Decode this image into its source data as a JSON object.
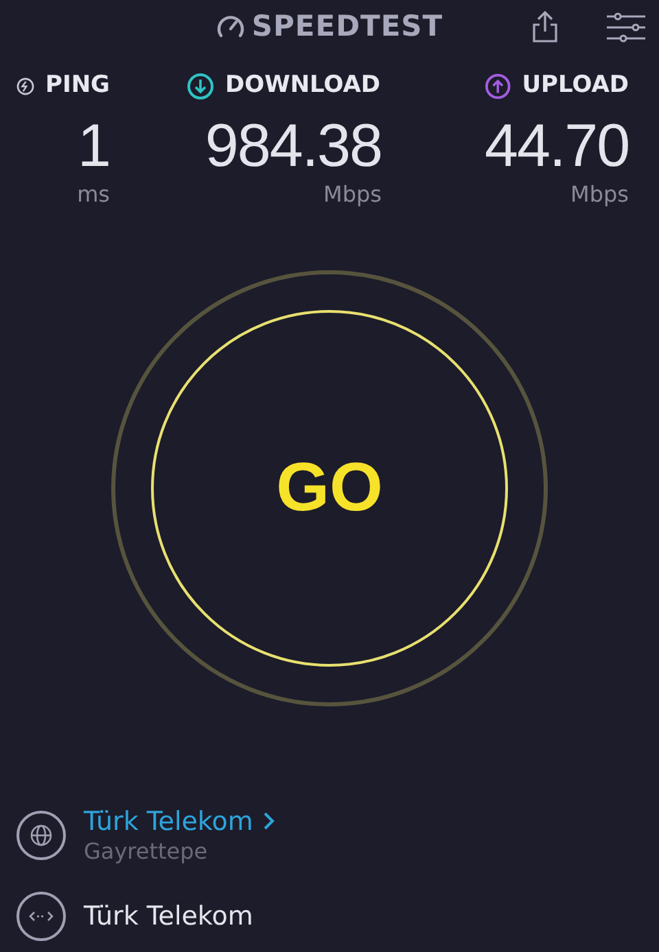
{
  "header": {
    "logo": "SPEEDTEST"
  },
  "metrics": [
    {
      "kind": "ping",
      "label": "PING",
      "value": "1",
      "unit": "ms",
      "color": "#c8c8d4"
    },
    {
      "kind": "download",
      "label": "DOWNLOAD",
      "value": "984.38",
      "unit": "Mbps",
      "color": "#2ec4c4"
    },
    {
      "kind": "upload",
      "label": "UPLOAD",
      "value": "44.70",
      "unit": "Mbps",
      "color": "#a35de0"
    }
  ],
  "go_button": {
    "label": "GO"
  },
  "connections": [
    {
      "kind": "server",
      "name": "Türk Telekom",
      "location": "Gayrettepe"
    },
    {
      "kind": "isp",
      "name": "Türk Telekom"
    }
  ]
}
